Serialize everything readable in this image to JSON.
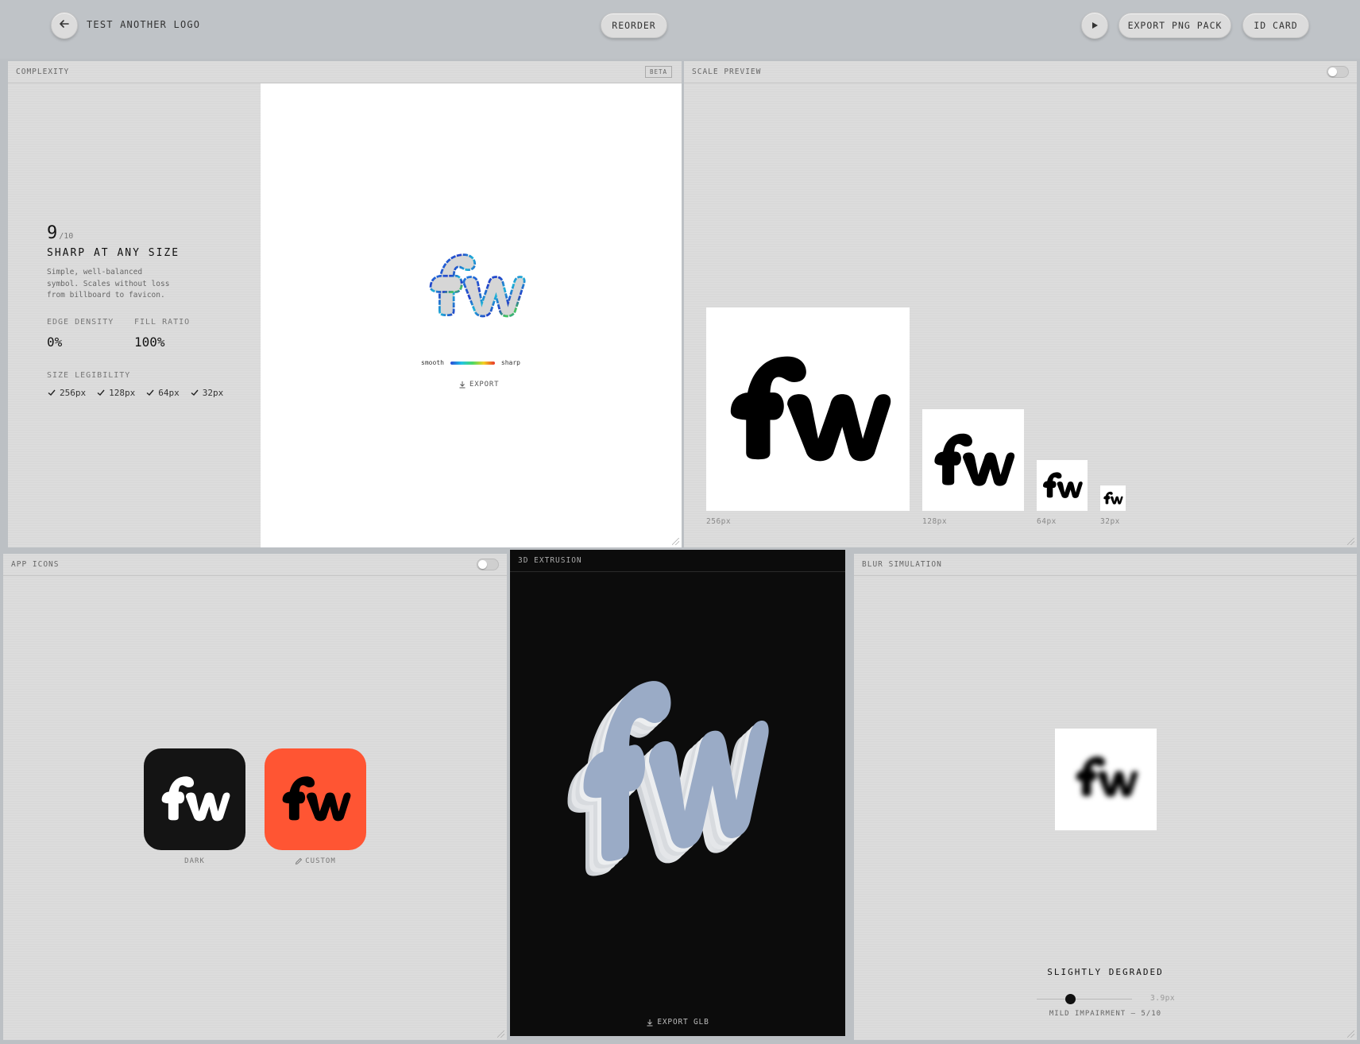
{
  "header": {
    "back_label": "back",
    "title": "TEST ANOTHER LOGO",
    "reorder": "REORDER",
    "export_png_pack": "EXPORT PNG PACK",
    "id_card": "ID CARD"
  },
  "complexity": {
    "header": "COMPLEXITY",
    "badge": "BETA",
    "score": "9",
    "score_max": "/10",
    "verdict": "SHARP AT ANY SIZE",
    "description_lines": [
      "Simple, well-balanced",
      "symbol. Scales without loss",
      "from billboard to favicon."
    ],
    "edge_density_label": "EDGE DENSITY",
    "edge_density_value": "0%",
    "fill_ratio_label": "FILL RATIO",
    "fill_ratio_value": "100%",
    "legibility_label": "SIZE LEGIBILITY",
    "legibility": [
      "256px",
      "128px",
      "64px",
      "32px"
    ],
    "legend_smooth": "smooth",
    "legend_sharp": "sharp",
    "export": "EXPORT"
  },
  "scale_preview": {
    "header": "SCALE PREVIEW",
    "sizes": [
      "256px",
      "128px",
      "64px",
      "32px"
    ]
  },
  "app_icons": {
    "header": "APP ICONS",
    "dark_label": "DARK",
    "custom_label": "CUSTOM",
    "colors": {
      "dark": "#141414",
      "custom": "#ff5533"
    }
  },
  "extrusion": {
    "header": "3D EXTRUSION",
    "export": "EXPORT GLB"
  },
  "blur": {
    "header": "BLUR SIMULATION",
    "status": "SLIGHTLY DEGRADED",
    "value": "3.9px",
    "slider_fraction": 0.35,
    "impairment": "MILD IMPAIRMENT — 5/10"
  }
}
